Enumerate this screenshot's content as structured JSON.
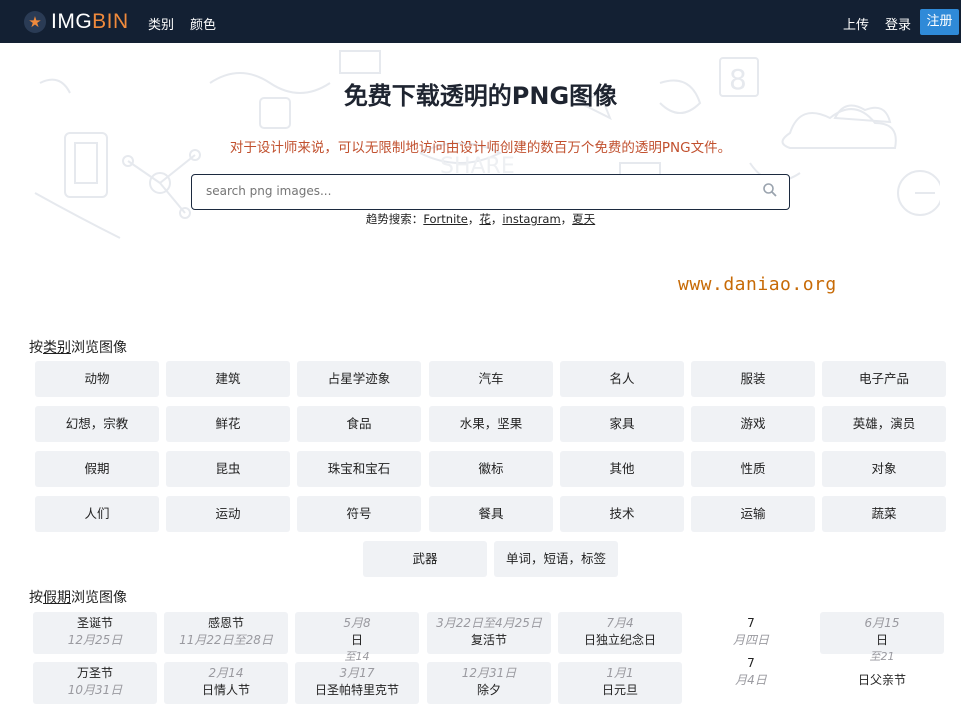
{
  "nav": {
    "logo_part1": "IMG",
    "logo_part2": "BIN",
    "categories": "类别",
    "colors": "颜色",
    "upload": "上传",
    "login": "登录",
    "register": "注册"
  },
  "hero": {
    "title": "免费下载透明的PNG图像",
    "subtitle": "对于设计师来说，可以无限制地访问由设计师创建的数百万个免费的透明PNG文件。",
    "search_placeholder": "search png images...",
    "trending_label": "趋势搜索：",
    "trending": [
      "Fortnite",
      "花",
      "instagram",
      "夏天"
    ]
  },
  "watermark": "www.daniao.org",
  "category_section": {
    "prefix": "按",
    "link": "类别",
    "suffix": "浏览图像"
  },
  "categories": [
    "动物",
    "建筑",
    "占星学迹象",
    "汽车",
    "名人",
    "服装",
    "电子产品",
    "幻想，宗教",
    "鲜花",
    "食品",
    "水果，坚果",
    "家具",
    "游戏",
    "英雄，演员",
    "假期",
    "昆虫",
    "珠宝和宝石",
    "徽标",
    "其他",
    "性质",
    "对象",
    "人们",
    "运动",
    "符号",
    "餐具",
    "技术",
    "运输",
    "蔬菜",
    "武器",
    "单词，短语，标签"
  ],
  "holiday_section": {
    "prefix": "按",
    "link": "假期",
    "suffix": "浏览图像"
  },
  "holidays": [
    {
      "name": "圣诞节",
      "date": "12月25日"
    },
    {
      "name": "感恩节",
      "date": "11月22日至28日"
    },
    {
      "date": "5月8",
      "name": "日",
      "extra": "至14"
    },
    {
      "date": "3月22日至4月25日",
      "name": "复活节"
    },
    {
      "date": "7月4",
      "name": "日独立纪念日"
    },
    {
      "date": "7",
      "name": "月四日"
    },
    {
      "date": "6月15",
      "name": "日",
      "extra": "至21"
    },
    {
      "name": "万圣节",
      "date": "10月31日"
    },
    {
      "date": "2月14",
      "name": "日情人节"
    },
    {
      "date": "3月17",
      "name": "日圣帕特里克节"
    },
    {
      "date": "12月31日",
      "name": "除夕"
    },
    {
      "date": "1月1",
      "name": "日元旦"
    },
    {
      "date": "7",
      "name": "月4日"
    },
    {
      "date": "",
      "name": "日父亲节"
    }
  ]
}
